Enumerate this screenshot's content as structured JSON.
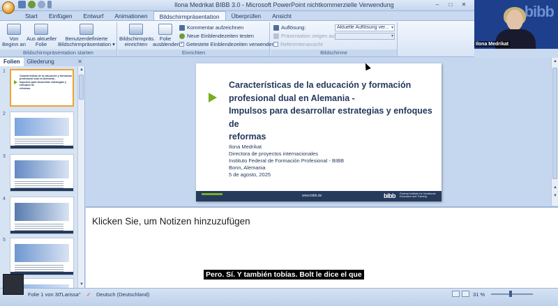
{
  "window": {
    "title": "Ilona Medrikat BIBB 3.0 - Microsoft PowerPoint nichtkommerzielle Verwendung",
    "controls": [
      "–",
      "□",
      "✕"
    ]
  },
  "ribbon_tabs": [
    {
      "label": "Start",
      "active": false
    },
    {
      "label": "Einfügen",
      "active": false
    },
    {
      "label": "Entwurf",
      "active": false
    },
    {
      "label": "Animationen",
      "active": false
    },
    {
      "label": "Bildschirmpräsentation",
      "active": true
    },
    {
      "label": "Überprüfen",
      "active": false
    },
    {
      "label": "Ansicht",
      "active": false
    }
  ],
  "ribbon": {
    "group_start": {
      "label": "Bildschirmpräsentation starten",
      "von_beginn": "Von\nBeginn an",
      "aus_aktueller": "Aus aktueller\nFolie",
      "benutzerdefiniert": "Benutzerdefinierte\nBildschirmpräsentation ▾"
    },
    "group_einrichten": {
      "label": "Einrichten",
      "einrichten_btn": "Bildschirmpräs.\neinrichten",
      "ausblenden_btn": "Folie\nausblenden",
      "kommentar": "Kommentar aufzeichnen",
      "einblendezeiten": "Neue Einblendezeiten testen",
      "gettestete": "Getestete Einblendezeiten verwenden"
    },
    "group_bildschirme": {
      "label": "Bildschirme",
      "aufloesung_label": "Auflösung:",
      "aufloesung_value": "Aktuelle Auflösung ver...",
      "praesentation_label": "Präsentation zeigen auf:",
      "referent": "Referentenansicht"
    }
  },
  "left_panel": {
    "tab_folien": "Folien",
    "tab_gliederung": "Gliederung",
    "close": "✕",
    "thumbs": [
      {
        "num": "1",
        "selected": true,
        "lines": [
          "Características de la educación y formación",
          "profesional dual en Alemania -",
          "Impulsos para desarrollar estrategias y enfoques de",
          "reformas"
        ]
      },
      {
        "num": "2",
        "selected": false,
        "lines": []
      },
      {
        "num": "3",
        "selected": false,
        "lines": []
      },
      {
        "num": "4",
        "selected": false,
        "lines": []
      },
      {
        "num": "5",
        "selected": false,
        "lines": []
      },
      {
        "num": "6",
        "selected": false,
        "lines": []
      }
    ]
  },
  "slide": {
    "title_lines": [
      "Características de la educación y formación",
      "profesional dual en Alemania -",
      "Impulsos para desarrollar estrategias y enfoques de",
      "reformas"
    ],
    "body_lines": [
      "Ilona Medrikat",
      "Directora de proyectos internacionales",
      "Instituto Federal de Formación Profesional - BIBB",
      "Bonn, Alemania",
      "5 de agosto, 2025"
    ],
    "footer_url": "www.bibb.de",
    "footer_logo": "bibb",
    "footer_logo_text": "Federal Institute for Vocational Education and Training",
    "accent_color": "#7bab21",
    "footer_color": "#253a5c"
  },
  "notes": {
    "placeholder": "Klicken Sie, um Notizen hinzuzufügen"
  },
  "statusbar": {
    "slide_info": "Folie 1 von 30",
    "theme": "\"Larissa\"",
    "language": "Deutsch (Deutschland)",
    "zoom": "31 %"
  },
  "subtitle": "Pero. Sí. Y también tobías. Bolt le dice el que",
  "webcam": {
    "name": "Ilona Medrikat",
    "bg_logo": "bibb"
  }
}
